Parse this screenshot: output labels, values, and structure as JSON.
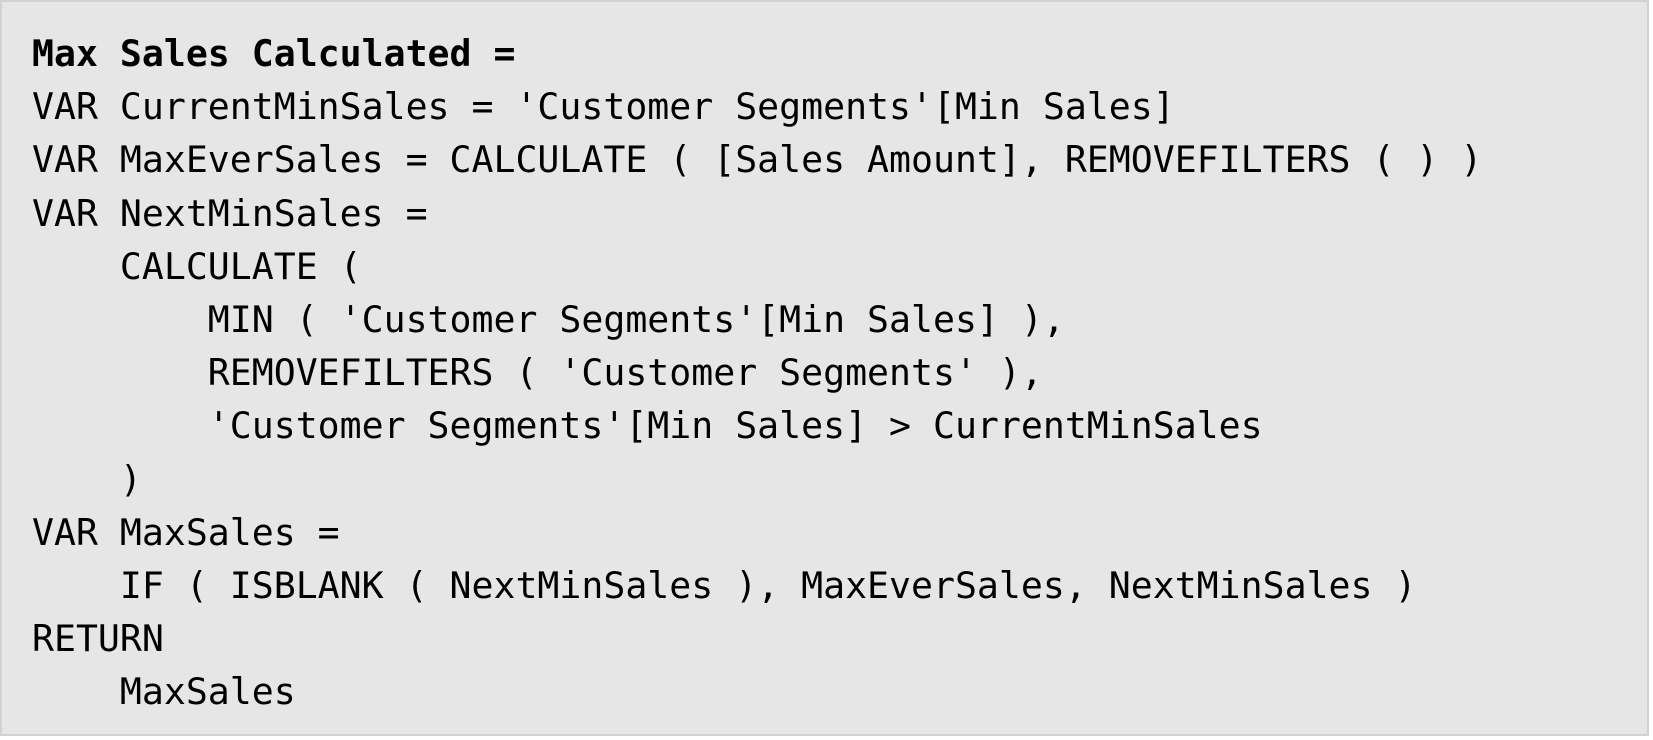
{
  "code": {
    "lines": [
      "Max Sales Calculated =",
      "VAR CurrentMinSales = 'Customer Segments'[Min Sales]",
      "VAR MaxEverSales = CALCULATE ( [Sales Amount], REMOVEFILTERS ( ) )",
      "VAR NextMinSales =",
      "    CALCULATE (",
      "        MIN ( 'Customer Segments'[Min Sales] ),",
      "        REMOVEFILTERS ( 'Customer Segments' ),",
      "        'Customer Segments'[Min Sales] > CurrentMinSales",
      "    )",
      "VAR MaxSales =",
      "    IF ( ISBLANK ( NextMinSales ), MaxEverSales, NextMinSales )",
      "RETURN",
      "    MaxSales"
    ]
  }
}
